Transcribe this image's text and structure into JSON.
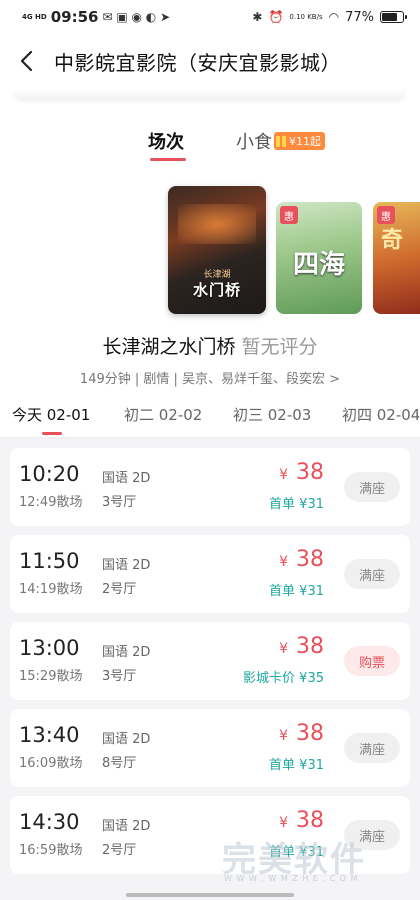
{
  "status_bar": {
    "network": "4G HD",
    "time": "09:56",
    "speed": "0.10 KB/s",
    "battery": "77%",
    "battery_level": 0.77
  },
  "nav": {
    "title": "中影皖宜影院（安庆宜影影城）"
  },
  "tabs": {
    "showtimes": "场次",
    "snacks": "小食",
    "snack_badge": "¥11起"
  },
  "posters": {
    "main_title": "水门桥",
    "main_subtitle": "长津湖",
    "second_title": "四海",
    "third_title": "奇",
    "badge": "惠"
  },
  "movie": {
    "title": "长津湖之水门桥",
    "rating": "暂无评分",
    "info": "149分钟 | 剧情 | 吴京、易烊千玺、段奕宏 >"
  },
  "dates": [
    {
      "label": "今天 02-01",
      "active": true
    },
    {
      "label": "初二 02-02",
      "active": false
    },
    {
      "label": "初三 02-03",
      "active": false
    },
    {
      "label": "初四 02-04",
      "active": false
    }
  ],
  "shows": [
    {
      "start": "10:20",
      "end": "12:49散场",
      "lang": "国语 2D",
      "hall": "3号厅",
      "price": "38",
      "discount": "首单 ¥31",
      "action": "满座",
      "buy": false
    },
    {
      "start": "11:50",
      "end": "14:19散场",
      "lang": "国语 2D",
      "hall": "2号厅",
      "price": "38",
      "discount": "首单 ¥31",
      "action": "满座",
      "buy": false
    },
    {
      "start": "13:00",
      "end": "15:29散场",
      "lang": "国语 2D",
      "hall": "3号厅",
      "price": "38",
      "discount": "影城卡价 ¥35",
      "action": "购票",
      "buy": true
    },
    {
      "start": "13:40",
      "end": "16:09散场",
      "lang": "国语 2D",
      "hall": "8号厅",
      "price": "38",
      "discount": "首单 ¥31",
      "action": "满座",
      "buy": false
    },
    {
      "start": "14:30",
      "end": "16:59散场",
      "lang": "国语 2D",
      "hall": "2号厅",
      "price": "38",
      "discount": "首单 ¥31",
      "action": "满座",
      "buy": false
    }
  ],
  "currency_symbol": "¥",
  "watermark": {
    "text": "完美软件",
    "sub": "W W W . W M Z H E . C O M"
  }
}
